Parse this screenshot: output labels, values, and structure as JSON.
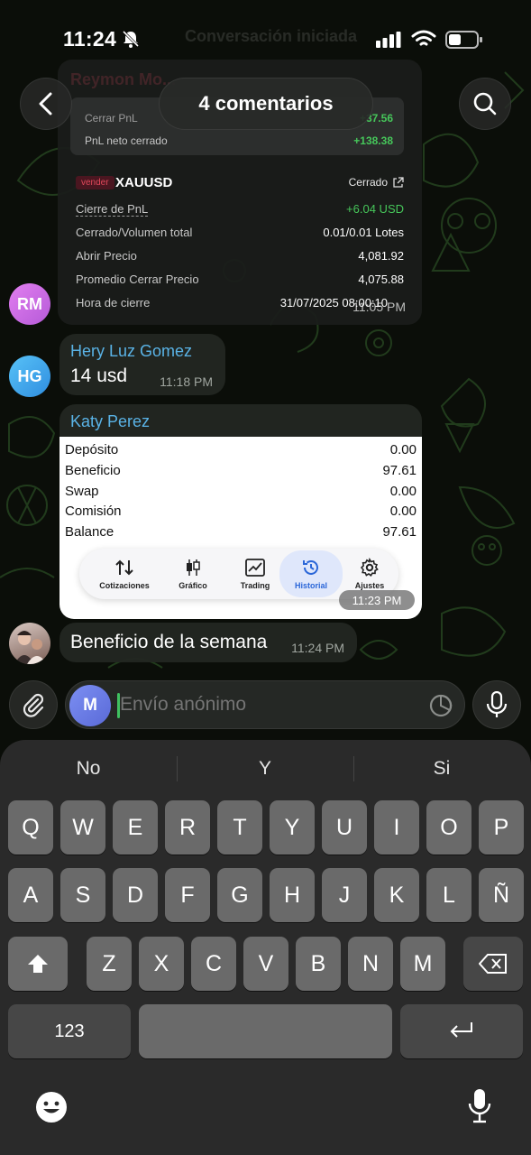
{
  "status_bar": {
    "time": "11:24"
  },
  "header": {
    "faint_title": "Conversación iniciada",
    "comments_label": "4 comentarios"
  },
  "trade_card": {
    "faint_name": "Reymon Mo...",
    "pnl_rows": [
      {
        "label": "Cerrar PnL",
        "value": "+37.56"
      },
      {
        "label": "PnL neto cerrado",
        "value": "+138.38"
      }
    ],
    "side_tag": "vender",
    "symbol": "XAUUSD",
    "status": "Cerrado",
    "rows": [
      {
        "label": "Cierre de PnL",
        "value": "+6.04 USD"
      },
      {
        "label": "Cerrado/Volumen total",
        "value": "0.01/0.01 Lotes"
      },
      {
        "label": "Abrir Precio",
        "value": "4,081.92"
      },
      {
        "label": "Promedio Cerrar Precio",
        "value": "4,075.88"
      },
      {
        "label": "Hora de cierre",
        "value": "31/07/2025 08:00:10"
      }
    ],
    "message_time": "11:05 PM"
  },
  "avatars": {
    "rm": "RM",
    "hg": "HG"
  },
  "messages": {
    "hery": {
      "sender": "Hery Luz Gomez",
      "text": "14 usd",
      "time": "11:18 PM"
    },
    "katy": {
      "sender": "Katy Perez",
      "account_rows": [
        {
          "label": "Depósito",
          "value": "0.00"
        },
        {
          "label": "Beneficio",
          "value": "97.61"
        },
        {
          "label": "Swap",
          "value": "0.00"
        },
        {
          "label": "Comisión",
          "value": "0.00"
        },
        {
          "label": "Balance",
          "value": "97.61"
        }
      ],
      "nav_items": [
        "Cotizaciones",
        "Gráfico",
        "Trading",
        "Historial",
        "Ajustes"
      ],
      "active_nav": "Historial",
      "time": "11:23 PM"
    },
    "benef": {
      "text": "Beneficio de la semana",
      "time": "11:24 PM"
    }
  },
  "composer": {
    "avatar_letter": "M",
    "placeholder": "Envío anónimo"
  },
  "keyboard": {
    "suggestions": [
      "No",
      "Y",
      "Si"
    ],
    "row1": [
      "Q",
      "W",
      "E",
      "R",
      "T",
      "Y",
      "U",
      "I",
      "O",
      "P"
    ],
    "row2": [
      "A",
      "S",
      "D",
      "F",
      "G",
      "H",
      "J",
      "K",
      "L",
      "Ñ"
    ],
    "row3": [
      "Z",
      "X",
      "C",
      "V",
      "B",
      "N",
      "M"
    ],
    "numbers_label": "123"
  },
  "colors": {
    "accent_green": "#46c75a",
    "sender_blue": "#5ab3e6",
    "active_tab": "#2a66d8"
  }
}
